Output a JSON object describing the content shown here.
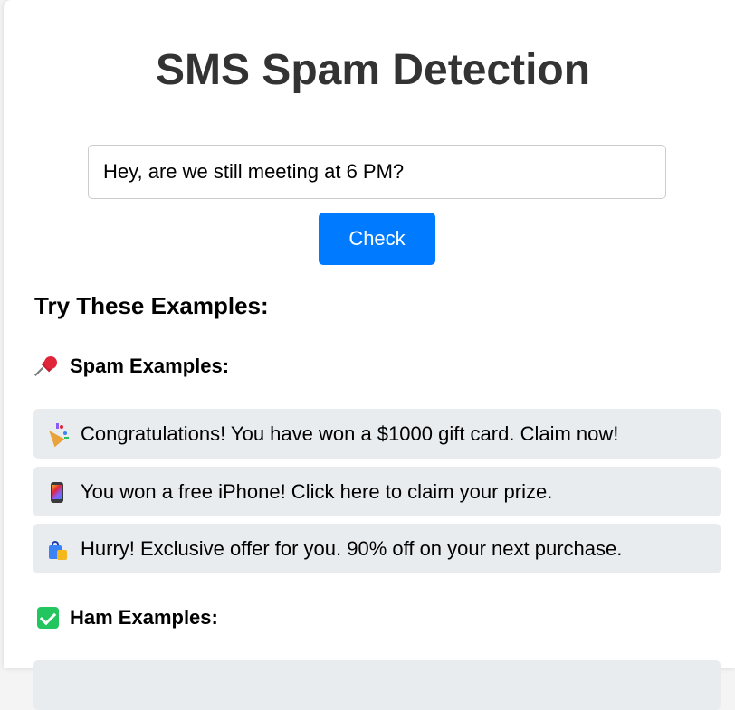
{
  "header": {
    "title": "SMS Spam Detection"
  },
  "form": {
    "message_value": "Hey, are we still meeting at 6 PM?",
    "check_label": "Check"
  },
  "examples": {
    "heading": "Try These Examples:",
    "spam": {
      "icon": "pushpin-icon",
      "heading": "Spam Examples:",
      "items": [
        {
          "icon": "party-popper-icon",
          "text": "Congratulations! You have won a $1000 gift card. Claim now!"
        },
        {
          "icon": "mobile-phone-icon",
          "text": "You won a free iPhone! Click here to claim your prize."
        },
        {
          "icon": "shopping-bags-icon",
          "text": "Hurry! Exclusive offer for you. 90% off on your next purchase."
        }
      ]
    },
    "ham": {
      "icon": "check-mark-icon",
      "heading": "Ham Examples:"
    }
  },
  "colors": {
    "primary_button": "#007bff",
    "example_background": "#e9ecef",
    "title_text": "#333333"
  }
}
